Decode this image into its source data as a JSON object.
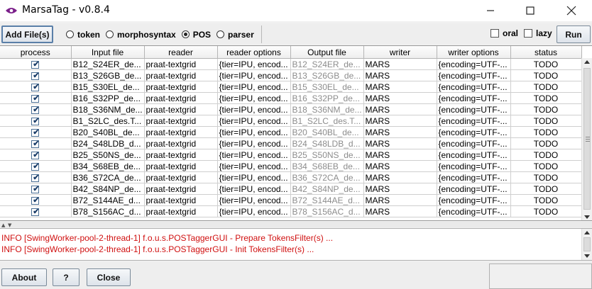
{
  "window": {
    "title": "MarsaTag - v0.8.4"
  },
  "toolbar": {
    "add_label": "Add File(s)",
    "radio_options": [
      {
        "label": "token",
        "checked": false
      },
      {
        "label": "morphosyntax",
        "checked": false
      },
      {
        "label": "POS",
        "checked": true
      },
      {
        "label": "parser",
        "checked": false
      }
    ],
    "oral_label": "oral",
    "lazy_label": "lazy",
    "run_label": "Run"
  },
  "table": {
    "columns": [
      "process",
      "Input file",
      "reader",
      "reader options",
      "Output file",
      "writer",
      "writer options",
      "status"
    ],
    "rows": [
      {
        "process": true,
        "input": "B12_S24ER_de...",
        "reader": "praat-textgrid",
        "reader_options": "{tier=IPU, encod...",
        "output": "B12_S24ER_de...",
        "writer": "MARS",
        "writer_options": "{encoding=UTF-...",
        "status": "TODO"
      },
      {
        "process": true,
        "input": "B13_S26GB_de...",
        "reader": "praat-textgrid",
        "reader_options": "{tier=IPU, encod...",
        "output": "B13_S26GB_de...",
        "writer": "MARS",
        "writer_options": "{encoding=UTF-...",
        "status": "TODO"
      },
      {
        "process": true,
        "input": "B15_S30EL_de...",
        "reader": "praat-textgrid",
        "reader_options": "{tier=IPU, encod...",
        "output": "B15_S30EL_de...",
        "writer": "MARS",
        "writer_options": "{encoding=UTF-...",
        "status": "TODO"
      },
      {
        "process": true,
        "input": "B16_S32PP_de...",
        "reader": "praat-textgrid",
        "reader_options": "{tier=IPU, encod...",
        "output": "B16_S32PP_de...",
        "writer": "MARS",
        "writer_options": "{encoding=UTF-...",
        "status": "TODO"
      },
      {
        "process": true,
        "input": "B18_S36NM_de...",
        "reader": "praat-textgrid",
        "reader_options": "{tier=IPU, encod...",
        "output": "B18_S36NM_de...",
        "writer": "MARS",
        "writer_options": "{encoding=UTF-...",
        "status": "TODO"
      },
      {
        "process": true,
        "input": "B1_S2LC_des.T...",
        "reader": "praat-textgrid",
        "reader_options": "{tier=IPU, encod...",
        "output": "B1_S2LC_des.T...",
        "writer": "MARS",
        "writer_options": "{encoding=UTF-...",
        "status": "TODO"
      },
      {
        "process": true,
        "input": "B20_S40BL_de...",
        "reader": "praat-textgrid",
        "reader_options": "{tier=IPU, encod...",
        "output": "B20_S40BL_de...",
        "writer": "MARS",
        "writer_options": "{encoding=UTF-...",
        "status": "TODO"
      },
      {
        "process": true,
        "input": "B24_S48LDB_d...",
        "reader": "praat-textgrid",
        "reader_options": "{tier=IPU, encod...",
        "output": "B24_S48LDB_d...",
        "writer": "MARS",
        "writer_options": "{encoding=UTF-...",
        "status": "TODO"
      },
      {
        "process": true,
        "input": "B25_S50NS_de...",
        "reader": "praat-textgrid",
        "reader_options": "{tier=IPU, encod...",
        "output": "B25_S50NS_de...",
        "writer": "MARS",
        "writer_options": "{encoding=UTF-...",
        "status": "TODO"
      },
      {
        "process": true,
        "input": "B34_S68EB_de...",
        "reader": "praat-textgrid",
        "reader_options": "{tier=IPU, encod...",
        "output": "B34_S68EB_de...",
        "writer": "MARS",
        "writer_options": "{encoding=UTF-...",
        "status": "TODO"
      },
      {
        "process": true,
        "input": "B36_S72CA_de...",
        "reader": "praat-textgrid",
        "reader_options": "{tier=IPU, encod...",
        "output": "B36_S72CA_de...",
        "writer": "MARS",
        "writer_options": "{encoding=UTF-...",
        "status": "TODO"
      },
      {
        "process": true,
        "input": "B42_S84NP_de...",
        "reader": "praat-textgrid",
        "reader_options": "{tier=IPU, encod...",
        "output": "B42_S84NP_de...",
        "writer": "MARS",
        "writer_options": "{encoding=UTF-...",
        "status": "TODO"
      },
      {
        "process": true,
        "input": "B72_S144AE_d...",
        "reader": "praat-textgrid",
        "reader_options": "{tier=IPU, encod...",
        "output": "B72_S144AE_d...",
        "writer": "MARS",
        "writer_options": "{encoding=UTF-...",
        "status": "TODO"
      },
      {
        "process": true,
        "input": "B78_S156AC_d...",
        "reader": "praat-textgrid",
        "reader_options": "{tier=IPU, encod...",
        "output": "B78_S156AC_d...",
        "writer": "MARS",
        "writer_options": "{encoding=UTF-...",
        "status": "TODO"
      }
    ]
  },
  "log": {
    "lines": [
      "INFO  [SwingWorker-pool-2-thread-1] f.o.u.s.POSTaggerGUI - Prepare TokensFilter(s) ...",
      "INFO  [SwingWorker-pool-2-thread-1] f.o.u.s.POSTaggerGUI - Init TokensFilter(s) ..."
    ]
  },
  "bottom": {
    "about_label": "About",
    "help_label": "?",
    "close_label": "Close"
  },
  "icons": {
    "app": "marsatag-eye-icon",
    "minimize": "minimize-icon",
    "maximize": "maximize-icon",
    "close": "close-icon"
  },
  "colors": {
    "log_text": "#d01010",
    "checkbox_tick": "#1d3f6a",
    "output_text": "#8c8c8c"
  }
}
